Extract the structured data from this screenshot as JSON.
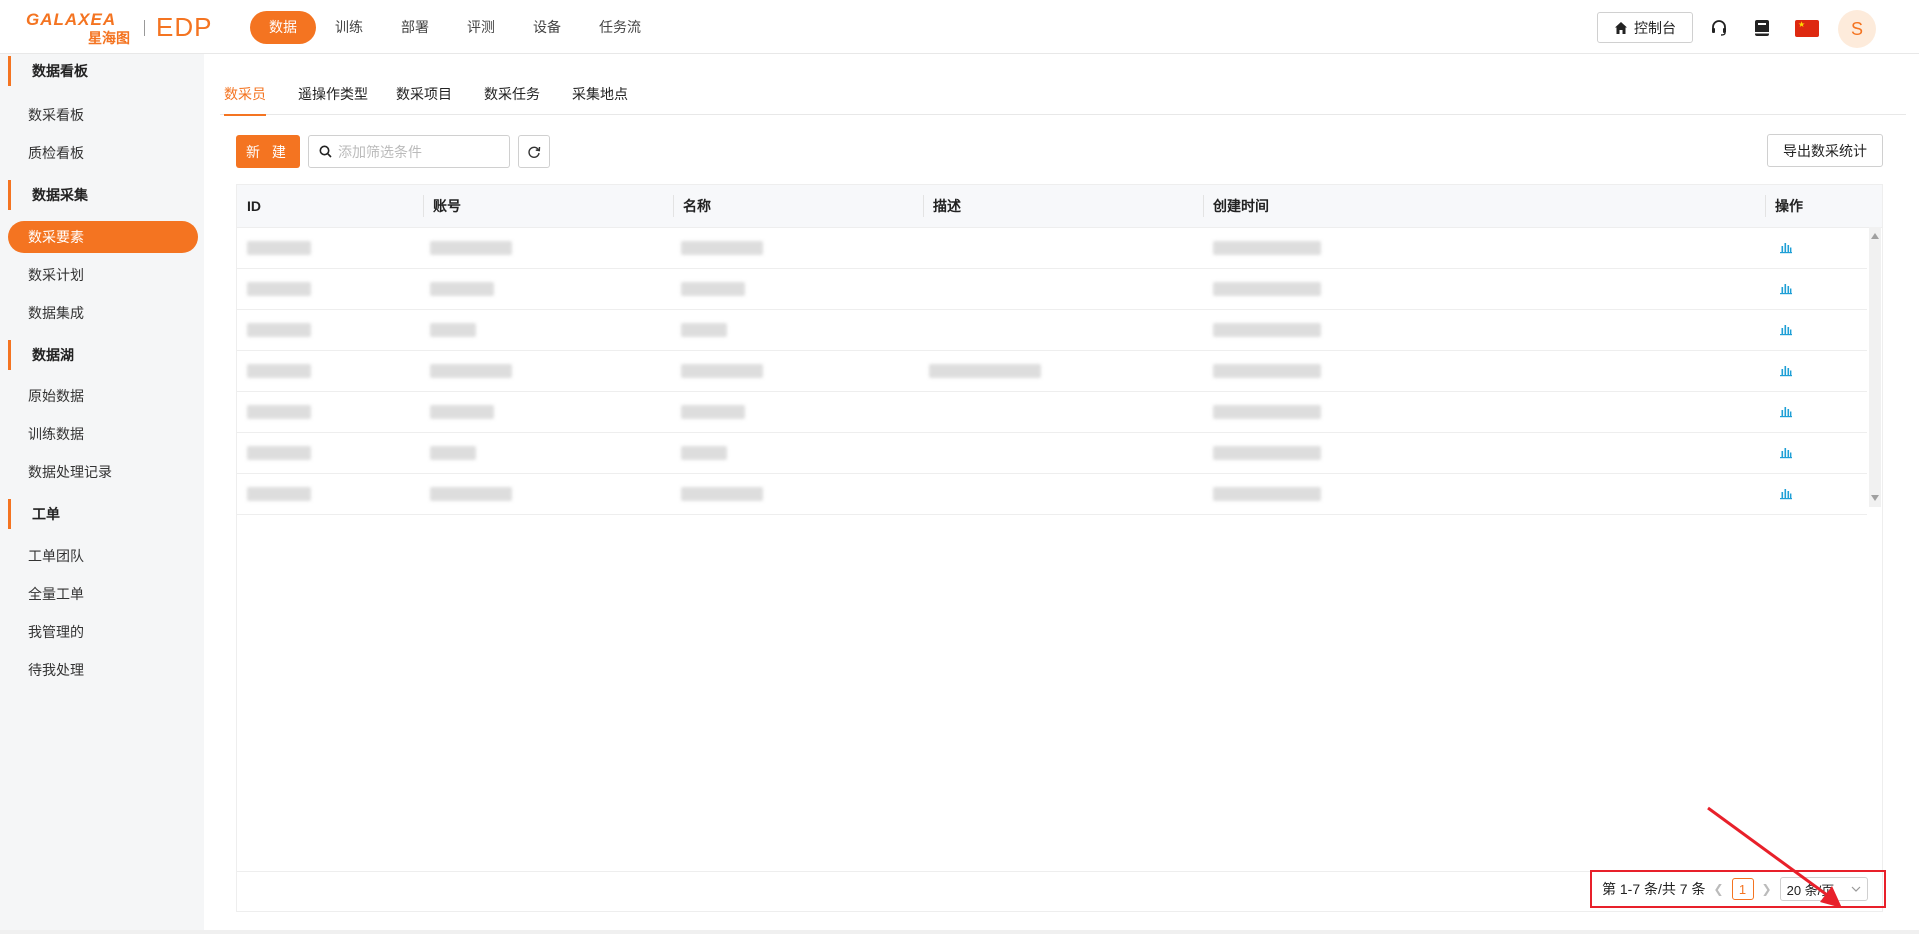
{
  "logo": {
    "brand": "GALAXEA",
    "sub": "星海图",
    "product": "EDP"
  },
  "nav": [
    {
      "label": "数据",
      "active": true
    },
    {
      "label": "训练",
      "active": false
    },
    {
      "label": "部署",
      "active": false
    },
    {
      "label": "评测",
      "active": false
    },
    {
      "label": "设备",
      "active": false
    },
    {
      "label": "任务流",
      "active": false
    }
  ],
  "header": {
    "console_label": "控制台",
    "avatar_letter": "S"
  },
  "sidebar": {
    "groups": [
      {
        "label": "数据看板",
        "items": [
          {
            "label": "数采看板"
          },
          {
            "label": "质检看板"
          }
        ]
      },
      {
        "label": "数据采集",
        "items": [
          {
            "label": "数采要素",
            "active": true
          },
          {
            "label": "数采计划"
          },
          {
            "label": "数据集成"
          }
        ]
      },
      {
        "label": "数据湖",
        "items": [
          {
            "label": "原始数据"
          },
          {
            "label": "训练数据"
          },
          {
            "label": "数据处理记录"
          }
        ]
      },
      {
        "label": "工单",
        "items": [
          {
            "label": "工单团队"
          },
          {
            "label": "全量工单"
          },
          {
            "label": "我管理的"
          },
          {
            "label": "待我处理"
          }
        ]
      }
    ]
  },
  "tabs": [
    {
      "label": "数采员",
      "active": true
    },
    {
      "label": "遥操作类型"
    },
    {
      "label": "数采项目"
    },
    {
      "label": "数采任务"
    },
    {
      "label": "采集地点"
    }
  ],
  "toolbar": {
    "new_label": "新 建",
    "search_placeholder": "添加筛选条件",
    "export_label": "导出数采统计"
  },
  "table": {
    "columns": [
      "ID",
      "账号",
      "名称",
      "描述",
      "创建时间",
      "操作"
    ],
    "row_count": 7,
    "rows": [
      {
        "has_desc": false
      },
      {
        "has_desc": false
      },
      {
        "has_desc": false
      },
      {
        "has_desc": true
      },
      {
        "has_desc": false
      },
      {
        "has_desc": false
      },
      {
        "has_desc": false
      }
    ]
  },
  "pagination": {
    "summary": "第 1-7 条/共 7 条",
    "current_page": "1",
    "page_size": "20 条/页"
  },
  "colors": {
    "accent": "#f47421",
    "highlight": "#e8202a",
    "op_icon": "#1e9fd6"
  },
  "icons": [
    "home-icon",
    "headset-icon",
    "book-icon",
    "china-flag-icon",
    "search-icon",
    "refresh-icon",
    "bar-chart-icon",
    "chevron-left-icon",
    "chevron-right-icon",
    "chevron-down-icon"
  ]
}
